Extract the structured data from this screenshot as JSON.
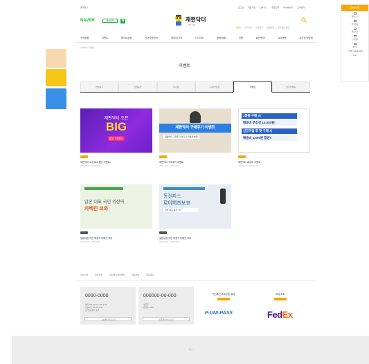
{
  "topbar": {
    "brand": "즐겨찾기",
    "links": [
      "로그인",
      "회원가입",
      "장바구니",
      "주문조회",
      "마이페이지",
      "고객센터"
    ]
  },
  "header": {
    "naver": "NAVER",
    "naver_pill": "페이센터",
    "naver_n": "N",
    "logo": "재편닥터",
    "logo_sub": "DR.JAE",
    "util": [
      "이벤트",
      "공지사항",
      "이용후기",
      "상품문의",
      "자주묻는질문"
    ]
  },
  "gnb": [
    "전체상품",
    "이벤트",
    "베스트상품",
    "건강식품/보조",
    "생리/임산부",
    "다이어트",
    "생활/잡화",
    "미용",
    "출산/육아",
    "유아동용",
    "유산균/영양제"
  ],
  "breadcrumb": "HOME > 이벤트",
  "page_title": "이벤트",
  "tabs": {
    "items": [
      "전체보기",
      "진행중인",
      "마감된",
      "기획전/당첨",
      "이벤트",
      "당첨자발표"
    ],
    "active_index": 4
  },
  "right_box": {
    "head": "오늘본상품",
    "items": [
      "장바구니",
      "관심상품",
      "배송조회",
      "고객센터",
      "이벤트"
    ],
    "tel": "고객센터 0000-0000",
    "top": "TOP"
  },
  "cards": [
    {
      "thumb": {
        "line1": "재편닥터 오픈",
        "big": "BIG",
        "badge": "할인 이벤트!"
      },
      "title": "재편닥터 오픈 BIG 할인 이벤트!",
      "date": "2020.00.00 ~ 2020.00.00"
    },
    {
      "thumb": {
        "band": "재편닥터 구매후기 이벤트",
        "sub": "재편닥터 구매후기 남기고 적립금 받자!"
      },
      "title": "재편닥터 구매후기 이벤트",
      "date": "2020.00.00 ~ 2020.00.00"
    },
    {
      "thumb": {
        "l1": "3종류 구매 시",
        "l2": "배송비 무조건 10,000원!",
        "l3": "신규가입 후 첫 구매 시",
        "l4": "배송비 1,000원 할인!"
      },
      "title": "재편닥터 배송비 이벤트",
      "date": "2020.00.00 ~ 2020.00.00"
    },
    {
      "thumb": {
        "line1": "일본 대표 국민 위장약",
        "line2": "카베진 코와"
      },
      "title": "일본대표 국민 위장약 카베진 코와",
      "date": "2020.00.00 ~ 2020.00.00"
    },
    {
      "thumb": {
        "line1": "동전파스",
        "line2": "로이히츠보코",
        "sub": "일본 대표 동전 파스"
      },
      "title": "일본대표 국민 위장약 카베진 코와",
      "date": "2020.00.00 ~ 2020.00.00"
    }
  ],
  "footer": {
    "links": [
      "회사소개",
      "이용약관",
      "개인정보처리방침",
      "이용안내",
      "제휴문의"
    ],
    "box1": {
      "num": "0000-0000",
      "lines": [
        "평일 AM 10:00 ~ PM 5:00",
        "점심시간 12:00~1:00",
        "토/일/공휴일 휴무"
      ],
      "btn": "고객센터 바로가기"
    },
    "box2": {
      "num": "000000-00-000",
      "lines": [
        "예금주",
        "은행명 : 000"
      ],
      "btn": "입금계좌 바로가기"
    },
    "box3": {
      "title": "개인통관고유부호 발급",
      "logo": "P-UNI-PASS"
    },
    "box4": {
      "title": "배송조회",
      "logo_a": "Fed",
      "logo_b": "Ex"
    },
    "bottom": "하단"
  }
}
